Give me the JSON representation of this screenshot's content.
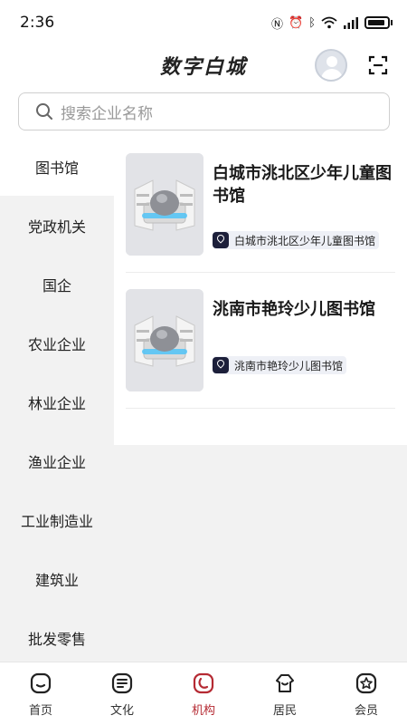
{
  "status": {
    "time": "2:36",
    "icons": [
      "nfc-icon",
      "alarm-icon",
      "bluetooth-icon",
      "wifi-icon",
      "signal-icon",
      "battery-icon"
    ]
  },
  "header": {
    "title": "数字白城"
  },
  "search": {
    "placeholder": "搜索企业名称"
  },
  "sidebar": {
    "items": [
      {
        "label": "图书馆",
        "active": true
      },
      {
        "label": "党政机关"
      },
      {
        "label": "国企"
      },
      {
        "label": "农业企业"
      },
      {
        "label": "林业企业"
      },
      {
        "label": "渔业企业"
      },
      {
        "label": "工业制造业"
      },
      {
        "label": "建筑业"
      },
      {
        "label": "批发零售"
      }
    ]
  },
  "list": [
    {
      "title": "白城市洮北区少年儿童图书馆",
      "tag": "白城市洮北区少年儿童图书馆"
    },
    {
      "title": "洮南市艳玲少儿图书馆",
      "tag": "洮南市艳玲少儿图书馆"
    }
  ],
  "tabs": [
    {
      "label": "首页",
      "icon": "home-icon"
    },
    {
      "label": "文化",
      "icon": "culture-icon"
    },
    {
      "label": "机构",
      "icon": "institution-icon",
      "active": true
    },
    {
      "label": "居民",
      "icon": "residents-icon"
    },
    {
      "label": "会员",
      "icon": "member-icon"
    }
  ],
  "colors": {
    "accent": "#b52a33",
    "sidebar_bg": "#f2f2f2",
    "tag_bg": "#eef0f6"
  }
}
